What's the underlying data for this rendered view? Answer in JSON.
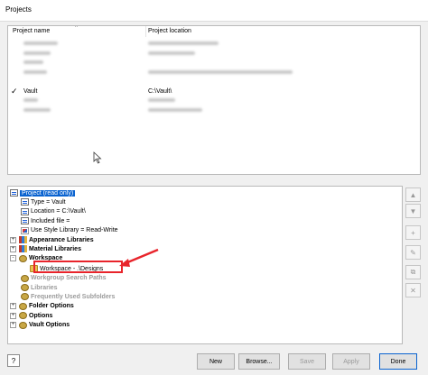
{
  "window": {
    "title": "Projects"
  },
  "project_list": {
    "columns": [
      "Project name",
      "Project location"
    ],
    "rows": [
      {
        "name": "",
        "location": "",
        "checked": false,
        "blurred": true
      },
      {
        "name": "",
        "location": "",
        "checked": false,
        "blurred": true
      },
      {
        "name": "",
        "location": "",
        "checked": false,
        "blurred": true
      },
      {
        "name": "",
        "location": "",
        "checked": false,
        "blurred": true
      },
      {
        "name": "",
        "location": "",
        "checked": false,
        "blurred": true
      },
      {
        "name": "Vault",
        "location": "C:\\Vault\\",
        "checked": true,
        "blurred": false
      },
      {
        "name": "",
        "location": "",
        "checked": false,
        "blurred": true
      },
      {
        "name": "",
        "location": "",
        "checked": false,
        "blurred": true
      }
    ]
  },
  "tree": {
    "items": [
      {
        "label": "Project (read only)",
        "icon": "project-icon",
        "style": "selected"
      },
      {
        "label": "Type = Vault",
        "icon": "document-icon"
      },
      {
        "label": "Location = C:\\Vault\\",
        "icon": "document-icon"
      },
      {
        "label": "Included file =",
        "icon": "document-icon"
      },
      {
        "label": "Use Style Library = Read-Write",
        "icon": "style-library-icon"
      },
      {
        "label": "Appearance Libraries",
        "icon": "library-icon",
        "style": "bold",
        "expander": "+"
      },
      {
        "label": "Material Libraries",
        "icon": "library-icon",
        "style": "bold",
        "expander": "+"
      },
      {
        "label": "Workspace",
        "icon": "workspace-icon",
        "style": "bold",
        "expander": "-"
      },
      {
        "label": "Workspace - .\\Designs",
        "icon": "folder-icon",
        "highlighted": true
      },
      {
        "label": "Workgroup Search Paths",
        "icon": "workspace-icon",
        "style": "gray"
      },
      {
        "label": "Libraries",
        "icon": "workspace-icon",
        "style": "gray"
      },
      {
        "label": "Frequently Used Subfolders",
        "icon": "workspace-icon",
        "style": "gray"
      },
      {
        "label": "Folder Options",
        "icon": "workspace-icon",
        "style": "bold",
        "expander": "+"
      },
      {
        "label": "Options",
        "icon": "workspace-icon",
        "style": "bold",
        "expander": "+"
      },
      {
        "label": "Vault Options",
        "icon": "workspace-icon",
        "style": "bold",
        "expander": "+"
      }
    ]
  },
  "side_buttons": [
    {
      "icon": "move-up-icon",
      "glyph": "▲"
    },
    {
      "icon": "move-down-icon",
      "glyph": "▼"
    },
    {
      "icon": "add-icon",
      "glyph": "+"
    },
    {
      "icon": "edit-icon",
      "glyph": "✎"
    },
    {
      "icon": "find-icon",
      "glyph": "⧉"
    },
    {
      "icon": "remove-icon",
      "glyph": "✕"
    }
  ],
  "footer": {
    "help_glyph": "?",
    "buttons": {
      "new": "New",
      "browse": "Browse...",
      "save": "Save",
      "apply": "Apply",
      "done": "Done"
    }
  },
  "colors": {
    "selection": "#0a63d0",
    "highlight_box": "#e8242b"
  }
}
